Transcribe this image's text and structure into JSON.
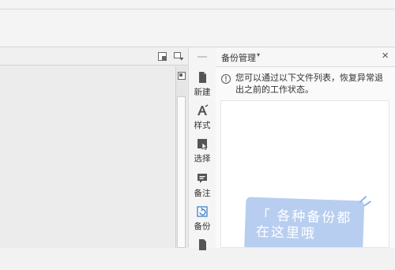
{
  "window": {
    "ribbon_area": "blank"
  },
  "doc_toolbar": {
    "buttons": [
      "window-restore-icon",
      "window-menu-icon"
    ]
  },
  "tool_column": {
    "items": [
      {
        "id": "new",
        "label": "新建",
        "icon": "new-document-icon"
      },
      {
        "id": "style",
        "label": "样式",
        "icon": "style-icon"
      },
      {
        "id": "select",
        "label": "选择",
        "icon": "select-cursor-icon"
      },
      {
        "id": "comment",
        "label": "备注",
        "icon": "comment-icon"
      },
      {
        "id": "backup",
        "label": "备份",
        "icon": "backup-icon"
      }
    ]
  },
  "backup_panel": {
    "title": "备份管理",
    "dropdown_caret": "▾",
    "close": "×",
    "info_symbol": "!",
    "info": "您可以通过以下文件列表，恢复异常退出之前的工作状态。",
    "empty_card_text": "「 各种备份都在这里哦",
    "accent_color": "#b8cef0"
  }
}
